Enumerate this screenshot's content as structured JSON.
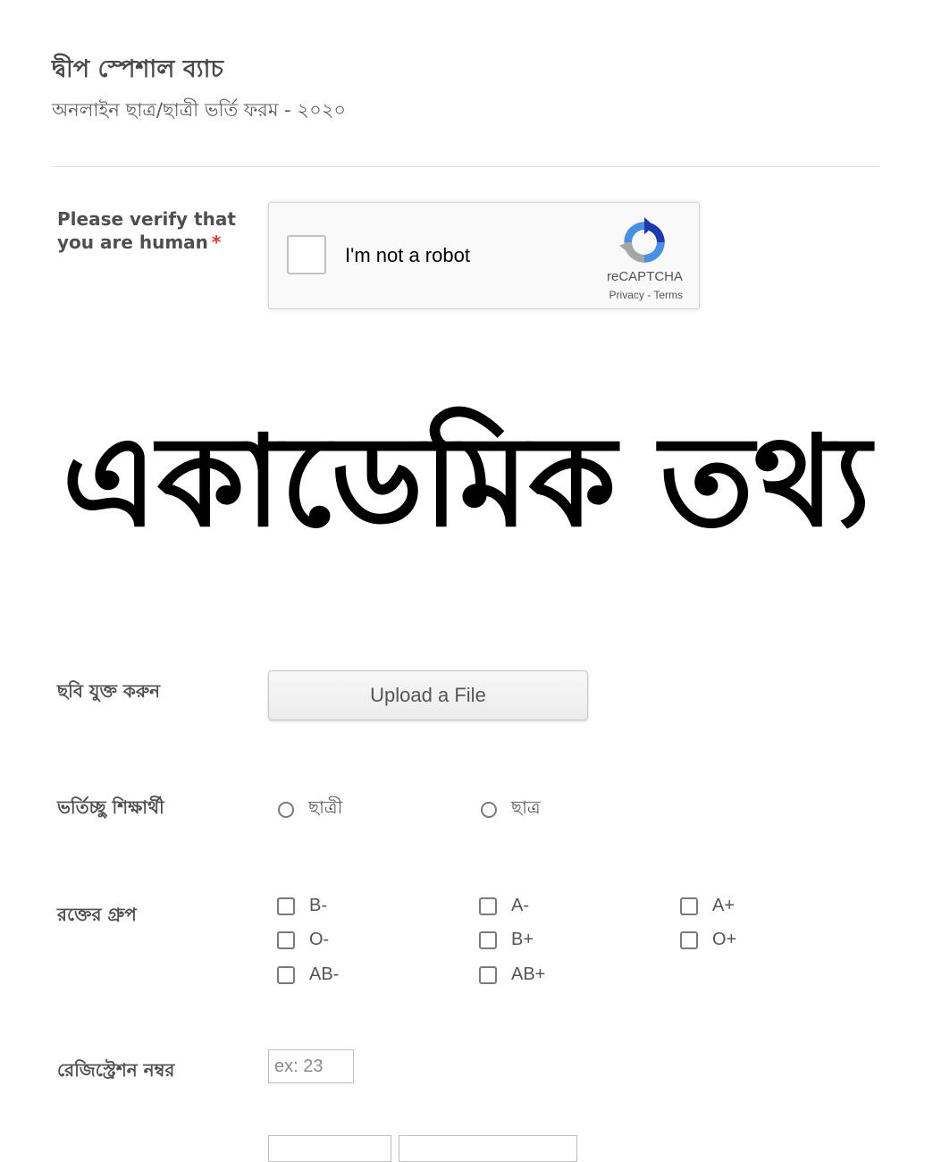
{
  "header": {
    "title": "দ্বীপ স্পেশাল ব্যাচ",
    "subtitle": "অনলাইন ছাত্র/ছাত্রী ভর্তি ফরম - ২০২০"
  },
  "captcha": {
    "question_label": "Please verify that you are human",
    "required_mark": "*",
    "checkbox_label": "I'm not a robot",
    "brand": "reCAPTCHA",
    "privacy": "Privacy",
    "separator": " - ",
    "terms": "Terms"
  },
  "section_heading": "একাডেমিক তথ্য",
  "photo": {
    "label": "ছবি যুক্ত করুন",
    "button_label": "Upload a File"
  },
  "student_type": {
    "label": "ভর্তিচ্ছু শিক্ষার্থী",
    "options": [
      "ছাত্রী",
      "ছাত্র"
    ]
  },
  "blood_group": {
    "label": "রক্তের গ্রুপ",
    "options": [
      "B-",
      "A-",
      "A+",
      "O-",
      "B+",
      "O+",
      "AB-",
      "AB+"
    ]
  },
  "registration": {
    "label": "রেজিস্ট্রেশন নম্বর",
    "placeholder": "ex: 23"
  },
  "colors": {
    "required": "#e0342b",
    "recaptcha_blue": "#4a90e2",
    "recaptcha_gray": "#a6a6a6"
  }
}
